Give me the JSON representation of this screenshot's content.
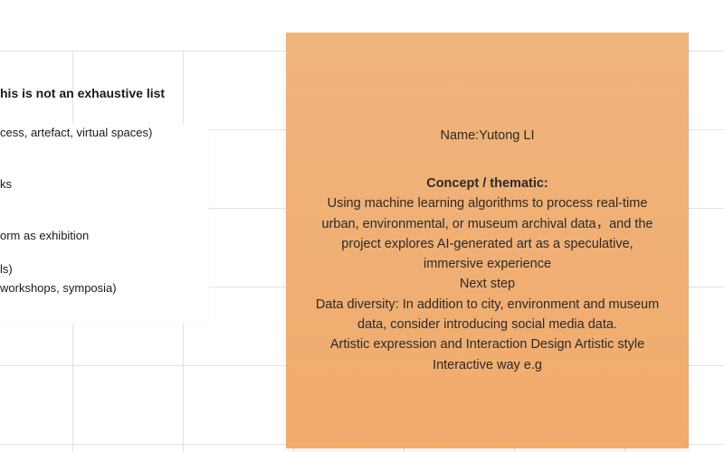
{
  "left_section": {
    "heading": "his is not an exhaustive list",
    "items": [
      "cess, artefact, virtual spaces)",
      "ks",
      "orm as exhibition",
      "ls)",
      "workshops, symposia)"
    ]
  },
  "sticky_note": {
    "name": "Name:Yutong LI",
    "concept_title": "Concept / thematic:",
    "concept_text": "Using machine learning algorithms to process real-time urban, environmental, or museum archival data，and the project explores AI-generated art as a speculative, immersive experience",
    "next_step": "Next step",
    "data_diversity": "Data diversity: In addition to city, environment and museum data, consider introducing social media data.",
    "artistic": "Artistic expression and Interaction Design  Artistic style Interactive way e.g",
    "color": "#F0B07A"
  }
}
